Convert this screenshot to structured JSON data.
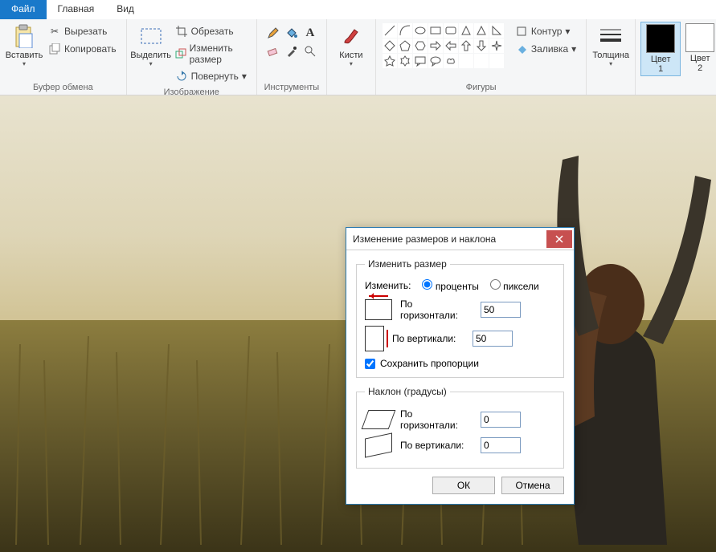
{
  "tabs": {
    "file": "Файл",
    "home": "Главная",
    "view": "Вид"
  },
  "ribbon": {
    "clipboard": {
      "paste": "Вставить",
      "cut": "Вырезать",
      "copy": "Копировать",
      "label": "Буфер обмена"
    },
    "image": {
      "select": "Выделить",
      "crop": "Обрезать",
      "resize": "Изменить размер",
      "rotate": "Повернуть",
      "label": "Изображение"
    },
    "tools": {
      "label": "Инструменты"
    },
    "brushes": {
      "label": "Кисти"
    },
    "shapes": {
      "outline": "Контур",
      "fill": "Заливка",
      "label": "Фигуры"
    },
    "thickness": {
      "label": "Толщина"
    },
    "colors": {
      "c1": "Цвет\n1",
      "c2": "Цвет\n2"
    }
  },
  "dialog": {
    "title": "Изменение размеров и наклона",
    "resize_group": "Изменить размер",
    "change_by": "Изменить:",
    "percent": "проценты",
    "pixels": "пиксели",
    "horizontal": "По горизонтали:",
    "vertical": "По вертикали:",
    "h_value": "50",
    "v_value": "50",
    "keep_ratio": "Сохранить пропорции",
    "skew_group": "Наклон (градусы)",
    "skew_h_value": "0",
    "skew_v_value": "0",
    "ok": "ОК",
    "cancel": "Отмена"
  }
}
